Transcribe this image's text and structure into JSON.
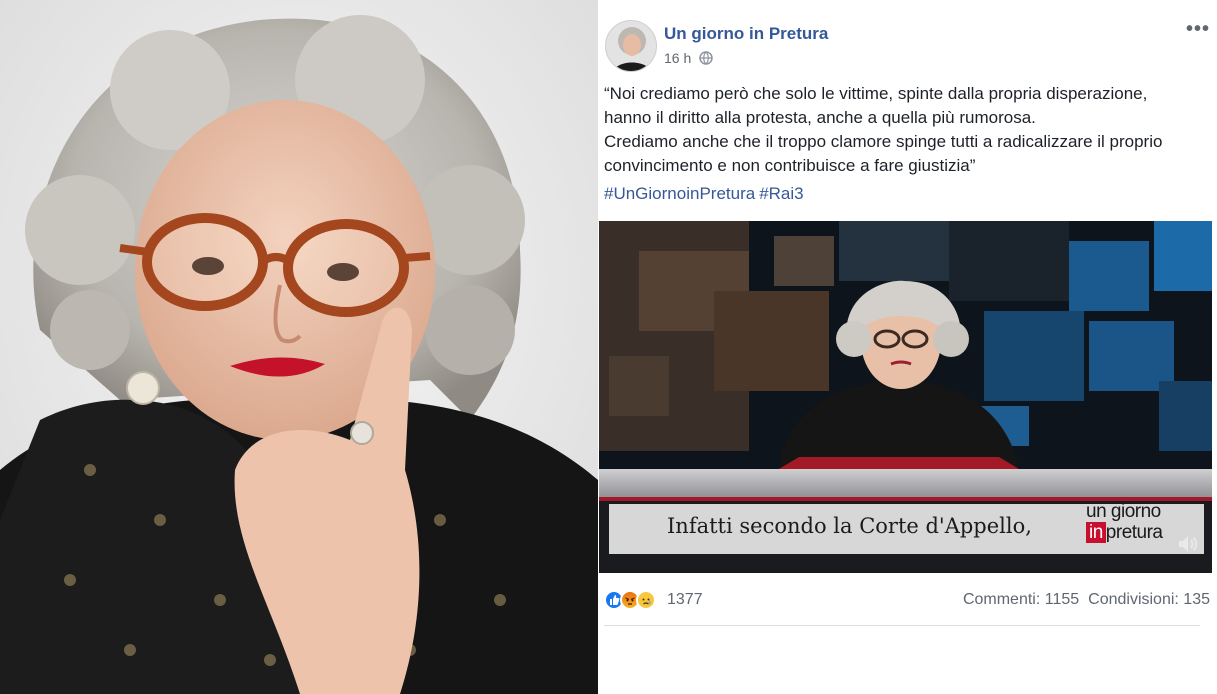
{
  "post": {
    "page_name": "Un giorno in Pretura",
    "timestamp": "16 h",
    "more_label": "•••",
    "text_lines": [
      "“Noi crediamo però che solo le vittime, spinte dalla propria disperazione,",
      "hanno il diritto alla protesta, anche a quella più rumorosa.",
      "Crediamo anche che il troppo clamore spinge tutti a radicalizzare il proprio",
      "convincimento e non contribuisce a fare giustizia”"
    ],
    "hashtags": [
      "#UnGiornoinPretura",
      "#Rai3"
    ]
  },
  "video": {
    "subtitle": "Infatti secondo la Corte d'Appello,",
    "logo_line1": "un giorno",
    "logo_in": "in",
    "logo_line2_rest": "pretura"
  },
  "engagement": {
    "reaction_count": "1377",
    "comments_label": "Commenti: 1155",
    "shares_label": "Condivisioni: 135"
  },
  "colors": {
    "link_blue": "#365899",
    "text": "#1d2129",
    "meta_grey": "#606770",
    "logo_red": "#c8102e"
  },
  "icons": [
    "globe-icon",
    "more-icon",
    "like-icon",
    "angry-icon",
    "sad-icon",
    "volume-icon"
  ]
}
